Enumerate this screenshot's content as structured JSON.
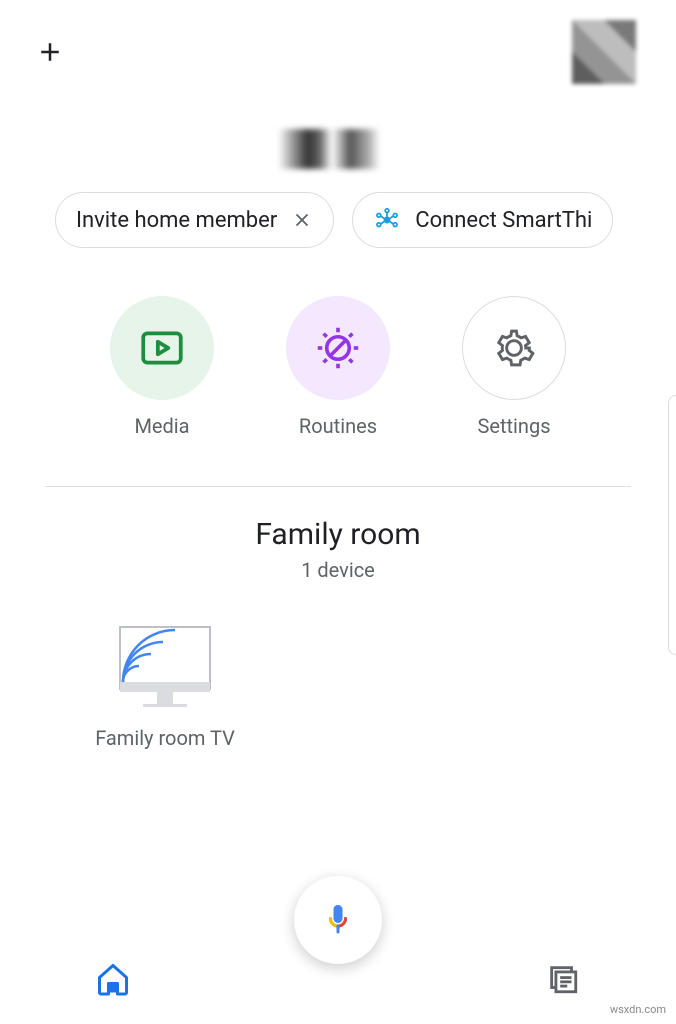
{
  "chips": {
    "invite": {
      "label": "Invite home member"
    },
    "connect": {
      "label": "Connect SmartThi"
    }
  },
  "actions": {
    "media": {
      "label": "Media"
    },
    "routines": {
      "label": "Routines"
    },
    "settings": {
      "label": "Settings"
    }
  },
  "room": {
    "title": "Family room",
    "subtitle": "1 device"
  },
  "devices": [
    {
      "label": "Family room TV"
    }
  ],
  "watermark": "wsxdn.com"
}
